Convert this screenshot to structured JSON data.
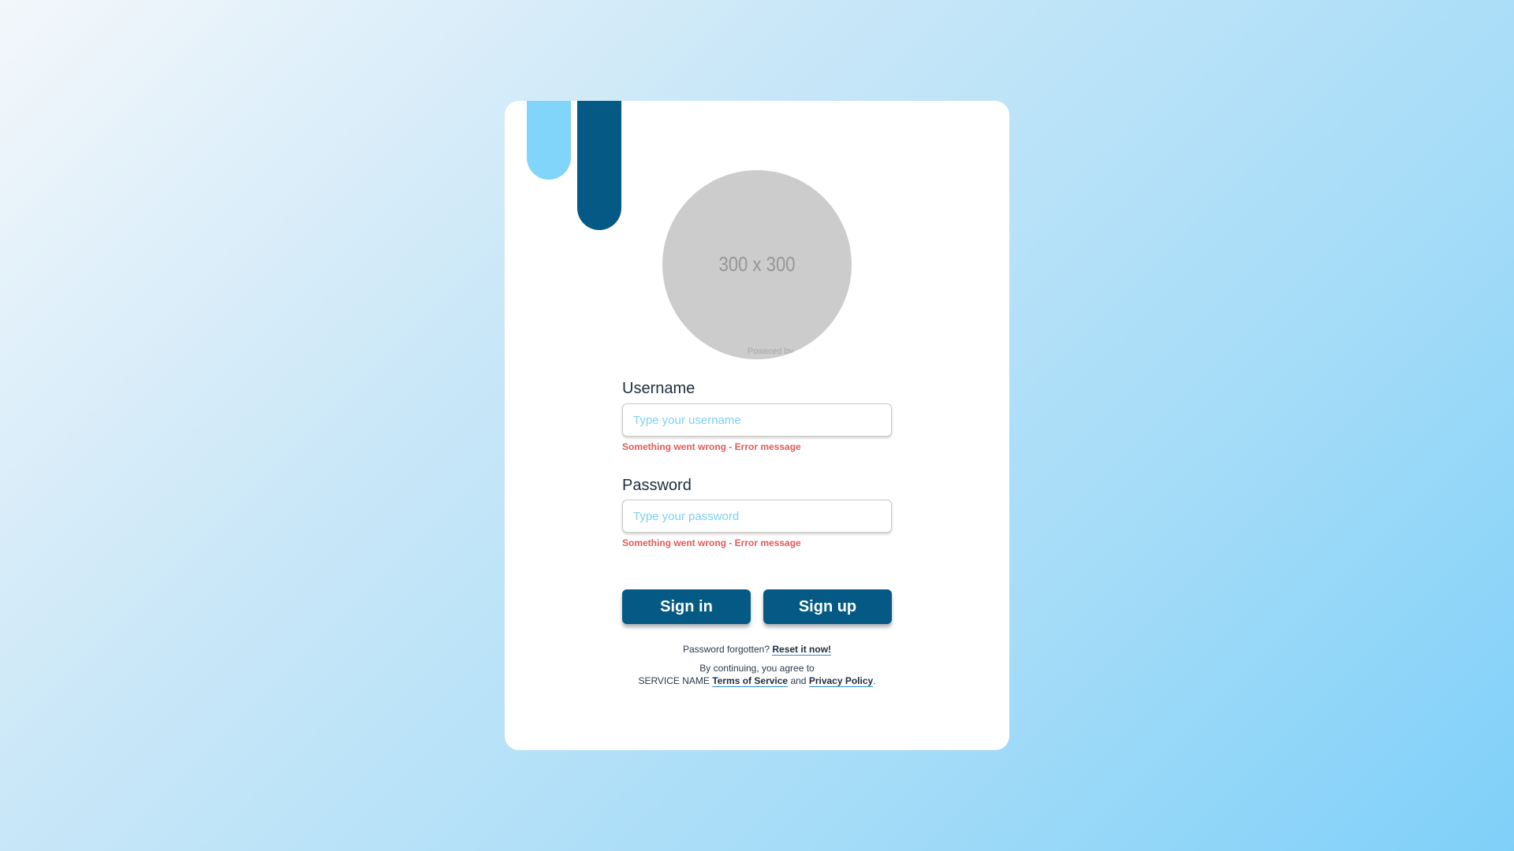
{
  "avatar": {
    "placeholder_text": "300 x 300",
    "credit_text": "Powered by"
  },
  "form": {
    "username": {
      "label": "Username",
      "placeholder": "Type your username",
      "value": "",
      "error": "Something went wrong - Error message"
    },
    "password": {
      "label": "Password",
      "placeholder": "Type your password",
      "value": "",
      "error": "Something went wrong - Error message"
    }
  },
  "actions": {
    "signin_label": "Sign in",
    "signup_label": "Sign up"
  },
  "footer": {
    "forgot_prefix": "Password forgotten?",
    "reset_link": "Reset it now!",
    "agree_line1": "By continuing, you agree to",
    "agree_service": "SERVICE NAME",
    "terms_link": "Terms of Service",
    "and_text": "and",
    "privacy_link": "Privacy Policy",
    "period": "."
  },
  "colors": {
    "brand_dark": "#055a85",
    "brand_light": "#81d4fa",
    "error": "#e35a5a",
    "placeholder": "#7fcff5"
  }
}
